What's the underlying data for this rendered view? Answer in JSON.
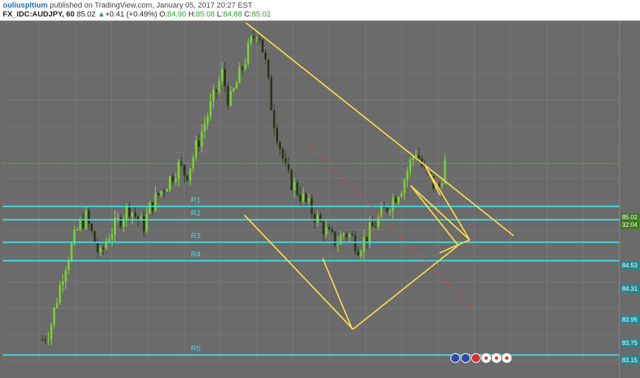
{
  "header": {
    "author": "ouliuspltium",
    "published": "published on TradingView.com, January 05, 2017 20:27 EST",
    "symbol": "FX_IDC:AUDJPY, 60",
    "last": "85.02",
    "up_arrow": "▲",
    "change": "+0.41 (+0.49%)",
    "o_label": "O:",
    "o_value": "84.90",
    "h_label": "H:",
    "h_value": "85.08",
    "l_label": "L:",
    "l_value": "84.88",
    "c_label": "C:",
    "c_value": "85.02"
  },
  "chart_data": {
    "type": "candlestick",
    "symbol": "AUDJPY",
    "ylim": [
      83.1,
      86.4
    ],
    "price_badges": [
      {
        "value": "85.02",
        "role": "current"
      },
      {
        "value": "32:04",
        "role": "countdown"
      },
      {
        "value": "84.53"
      },
      {
        "value": "84.31"
      },
      {
        "value": "83.95"
      },
      {
        "value": "83.75"
      },
      {
        "value": "83.15"
      }
    ],
    "levels": [
      {
        "label": "R1",
        "value": 84.6
      },
      {
        "label": "R2",
        "value": 84.47
      },
      {
        "label": "R3",
        "value": 84.25
      },
      {
        "label": "R4",
        "value": 84.07
      },
      {
        "label": "R5",
        "value": 83.15
      }
    ],
    "current_price_line": 85.02,
    "close_series": [
      83.3,
      83.4,
      83.7,
      84.0,
      84.2,
      84.4,
      84.5,
      84.3,
      84.1,
      84.3,
      84.4,
      84.5,
      84.6,
      84.5,
      84.4,
      84.6,
      84.7,
      84.8,
      84.9,
      85.0,
      84.9,
      85.1,
      85.3,
      85.5,
      85.7,
      85.9,
      85.6,
      85.8,
      86.0,
      86.2,
      86.35,
      86.0,
      85.5,
      85.2,
      84.9,
      84.8,
      84.7,
      84.6,
      84.5,
      84.4,
      84.3,
      84.25,
      84.35,
      84.3,
      84.2,
      84.3,
      84.4,
      84.5,
      84.6,
      84.7,
      84.8,
      85.0,
      85.15,
      84.95,
      84.85,
      84.75,
      85.02
    ],
    "series": [
      {
        "name": "Candles",
        "color": "#7bd12e"
      },
      {
        "name": "Trend lines",
        "color": "#f5d84f"
      },
      {
        "name": "Support/Resistance",
        "color": "#3fe0e6"
      },
      {
        "name": "Projection",
        "color": "#ff3b3b"
      }
    ],
    "event_icons": [
      "flag-au-icon",
      "flag-au-icon",
      "flag-cn-icon",
      "flag-jp-icon",
      "flag-jp-icon",
      "flag-jp-icon"
    ]
  },
  "colors": {
    "plot_bg": "#6b6b6b",
    "axis_bg": "#6b6b6b",
    "grid": "#787878",
    "level": "#3fe0e6",
    "trend": "#f5d84f",
    "current_line": "#5bd12e"
  }
}
